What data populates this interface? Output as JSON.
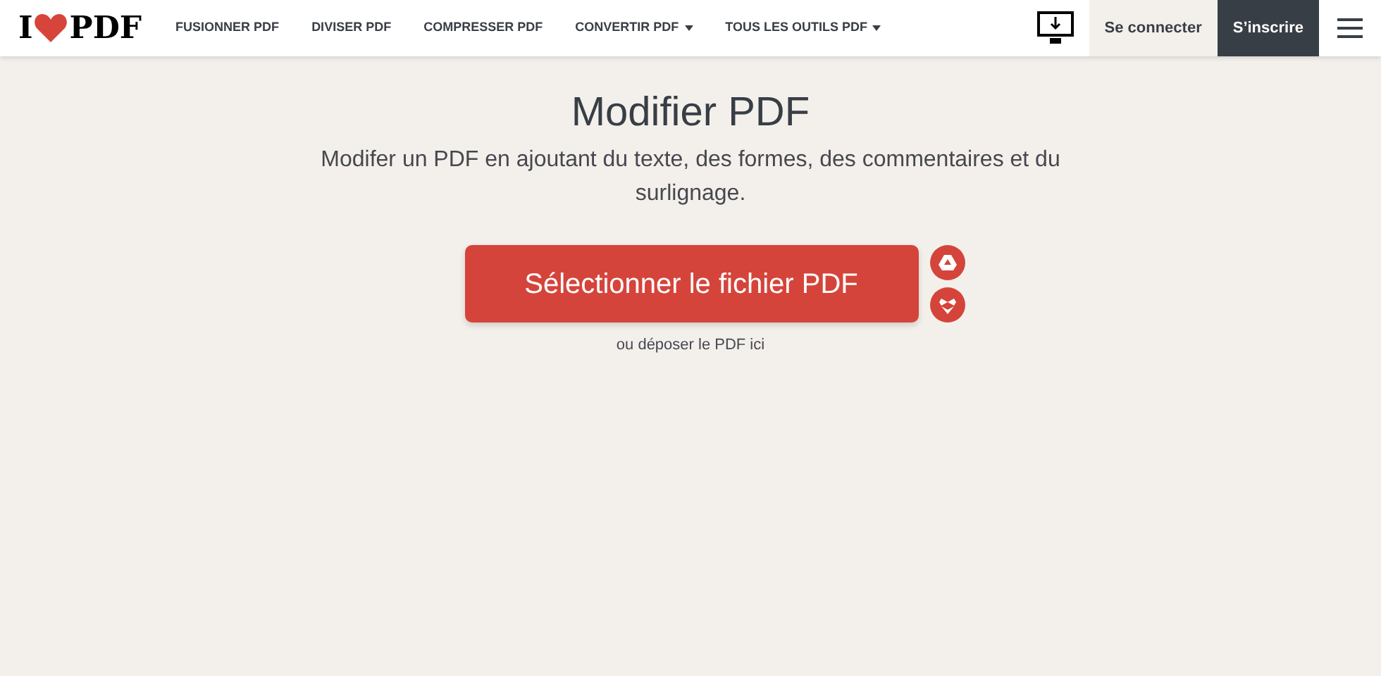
{
  "logo": {
    "left": "I",
    "right": "PDF"
  },
  "nav": [
    {
      "label": "FUSIONNER PDF",
      "dropdown": false
    },
    {
      "label": "DIVISER PDF",
      "dropdown": false
    },
    {
      "label": "COMPRESSER PDF",
      "dropdown": false
    },
    {
      "label": "CONVERTIR PDF",
      "dropdown": true
    },
    {
      "label": "TOUS LES OUTILS PDF",
      "dropdown": true
    }
  ],
  "login": "Se connecter",
  "signup": "S’inscrire",
  "title": "Modifier PDF",
  "subtitle": "Modifer un PDF en ajoutant du texte, des formes, des commentaires et du surlignage.",
  "upload_button": "Sélectionner le fichier PDF",
  "drop_hint": "ou déposer le PDF ici"
}
